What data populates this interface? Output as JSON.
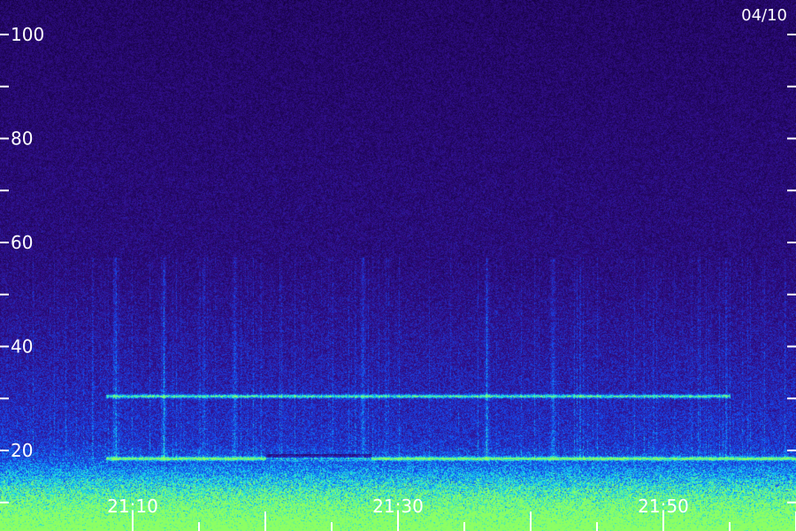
{
  "chart_data": {
    "type": "heatmap",
    "title": "",
    "date_label": "04/10",
    "xlabel": "",
    "ylabel": "",
    "y_axis": {
      "range": [
        10,
        110
      ],
      "major_ticks": [
        20,
        40,
        60,
        80,
        100
      ],
      "major_labels": [
        "20",
        "40",
        "60",
        "80",
        "100"
      ],
      "minor_ticks": [
        10,
        30,
        50,
        70,
        90
      ]
    },
    "x_axis": {
      "major_labels": [
        "21:10",
        "21:30",
        "21:50"
      ],
      "major_positions_min": [
        10,
        30,
        50
      ],
      "range_min": [
        8,
        61
      ],
      "tick_spacing_min": 5
    },
    "colors": {
      "background": "#2a0d6e",
      "mid": "#3a2aa8",
      "bright": "#1e5ef0",
      "cyan": "#20d0f0",
      "hot": "#40f0a0"
    },
    "features": [
      {
        "label": "horizontal band",
        "y": 30.5,
        "x_range": [
          8,
          55
        ]
      },
      {
        "label": "horizontal band",
        "y": 18.5,
        "x_range": [
          8,
          61
        ]
      },
      {
        "label": "broadband noise",
        "y_range": [
          10,
          20
        ],
        "x_range": [
          8,
          61
        ]
      }
    ]
  }
}
